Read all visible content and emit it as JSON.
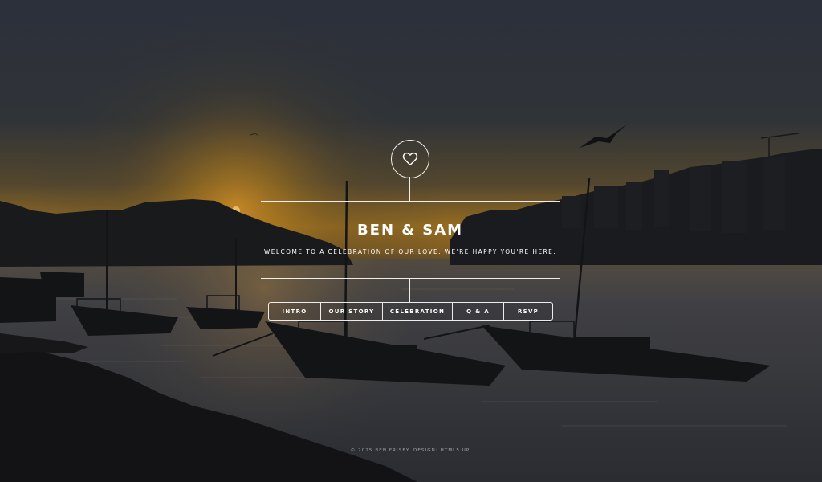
{
  "header": {
    "logo_icon": "heart-icon",
    "title": "BEN & SAM",
    "tagline": "Welcome to a celebration of our love. We're happy you're here."
  },
  "nav": {
    "items": [
      {
        "label": "Intro"
      },
      {
        "label": "Our Story"
      },
      {
        "label": "Celebration"
      },
      {
        "label": "Q & A"
      },
      {
        "label": "RSVP"
      }
    ]
  },
  "footer": {
    "copyright": "© 2025 Ben Frisby.",
    "design_prefix": "Design:",
    "design_link": "HTML5 UP."
  },
  "colors": {
    "sky_top": "#2f353f",
    "sunset_glow": "#c9891f",
    "water": "#3b3e45",
    "text": "#ffffff"
  }
}
